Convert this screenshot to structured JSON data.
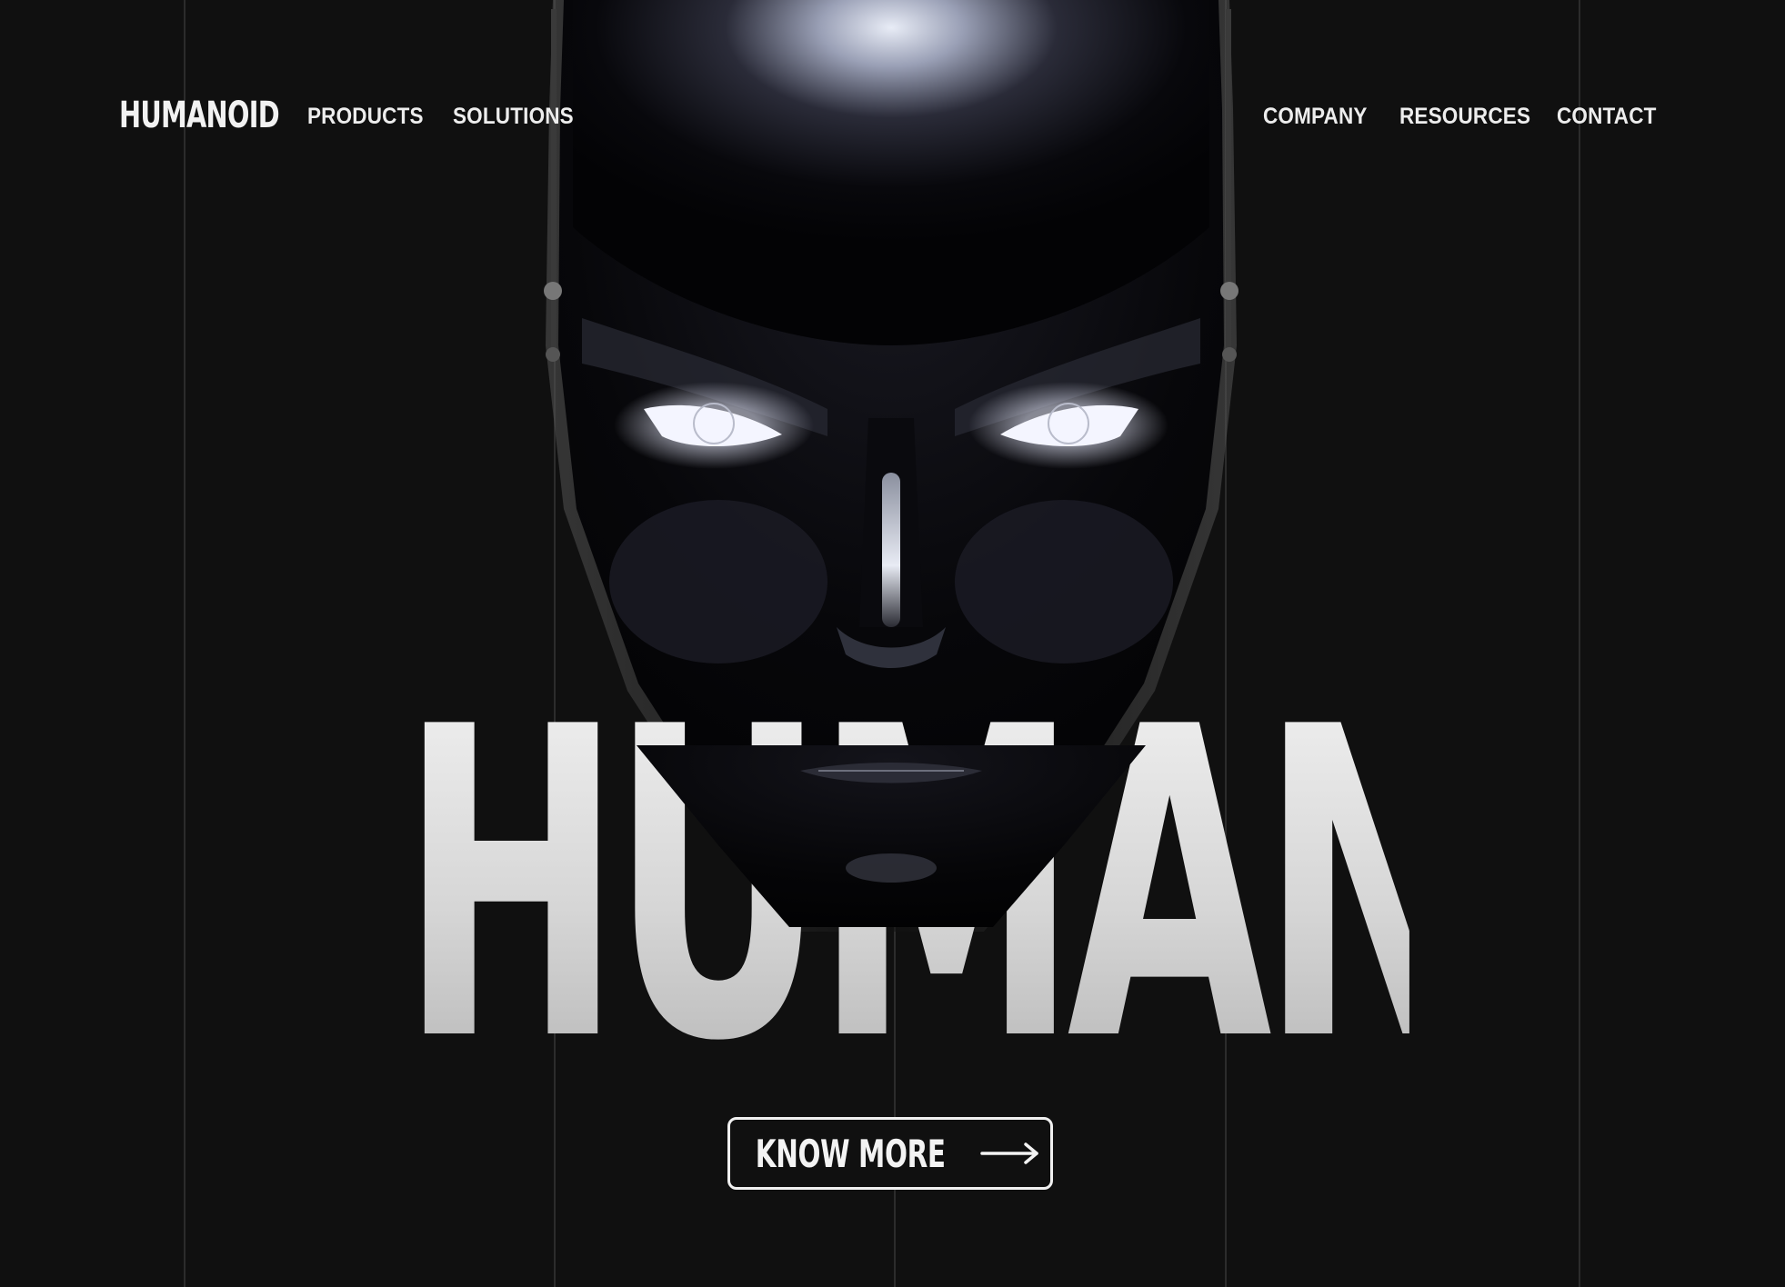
{
  "header": {
    "logo": "HUMANOID",
    "nav_left": [
      "PRODUCTS",
      "SOLUTIONS"
    ],
    "nav_right": [
      "COMPANY",
      "RESOURCES",
      "CONTACT"
    ]
  },
  "hero": {
    "title": "HUMANOID",
    "cta_label": "KNOW MORE",
    "cta_icon": "arrow-right-icon",
    "illustration": "robot-head-image"
  },
  "colors": {
    "background": "#101010",
    "text": "#f0f0f0",
    "grid_line": "#2c2c2c"
  }
}
